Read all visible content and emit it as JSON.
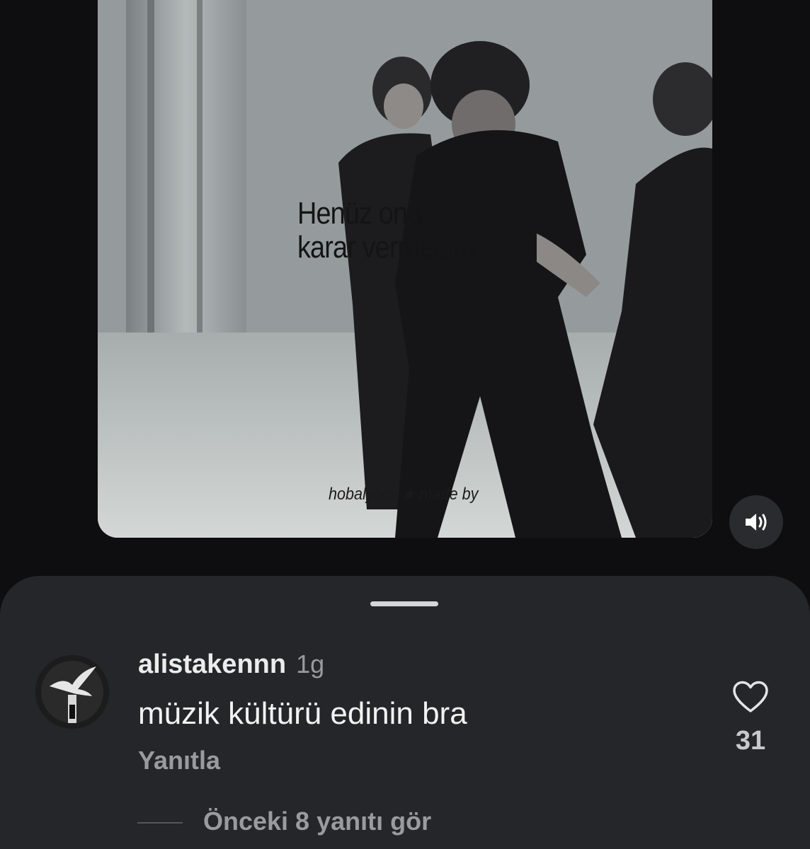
{
  "video": {
    "lyric_text": "Henüz ona\nkarar vermedim",
    "watermark": "hobalyrics ★ made by",
    "sound_icon": "speaker-volume-icon"
  },
  "comment": {
    "username": "alistakennn",
    "time": "1g",
    "text": "müzik kültürü edinin bra",
    "reply_label": "Yanıtla",
    "like_icon": "heart-outline-icon",
    "like_count": "31"
  },
  "replies": {
    "view_label": "Önceki 8 yanıtı gör"
  }
}
